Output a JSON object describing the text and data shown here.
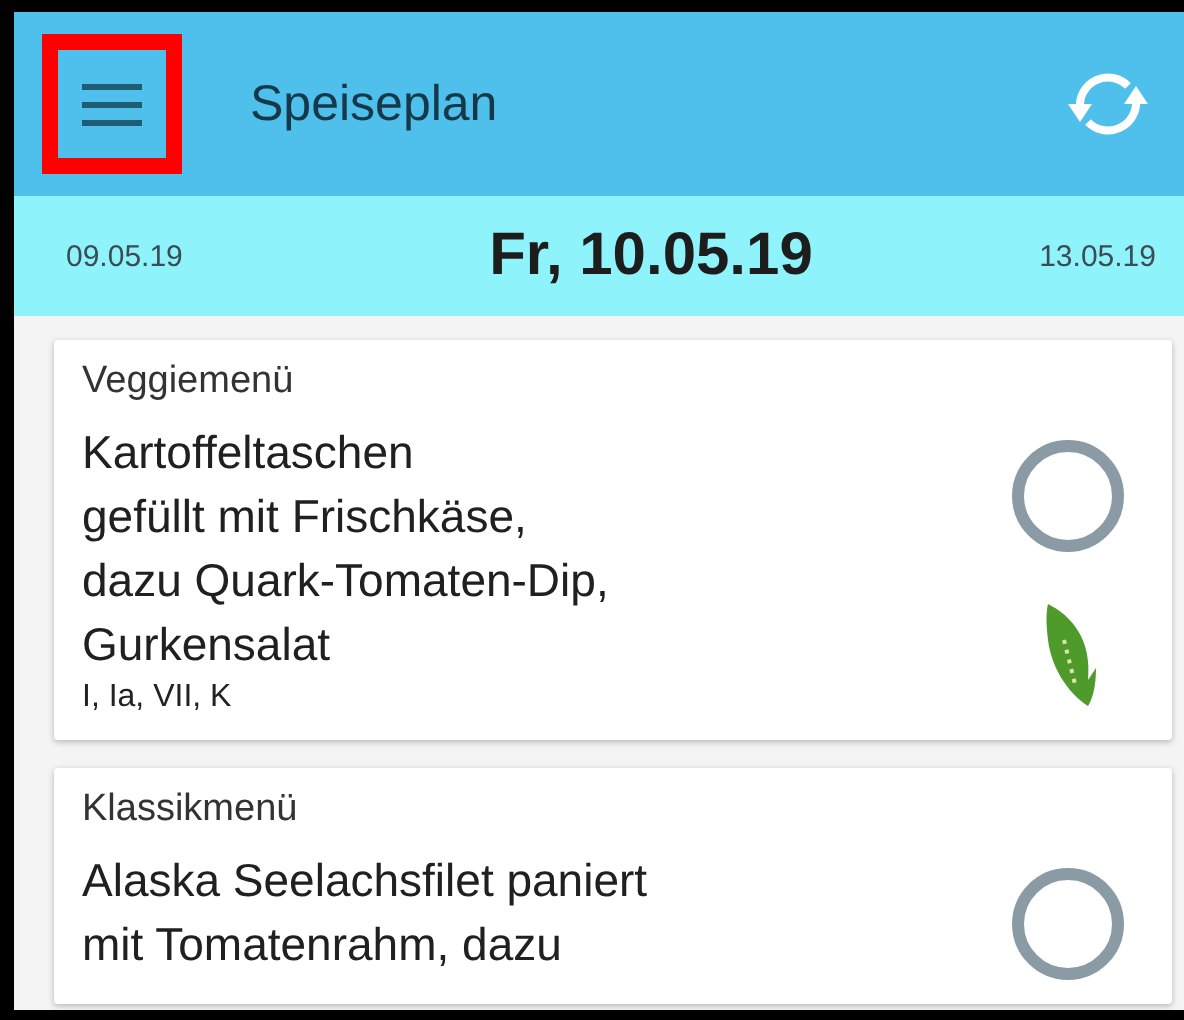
{
  "app_bar": {
    "title": "Speiseplan",
    "menu_highlighted": true
  },
  "date_bar": {
    "previous": "09.05.19",
    "current": "Fr, 10.05.19",
    "next": "13.05.19"
  },
  "menus": [
    {
      "category": "Veggiemenü",
      "lines": [
        "Kartoffeltaschen",
        "gefüllt mit Frischkäse,",
        "dazu Quark-Tomaten-Dip,",
        "Gurkensalat"
      ],
      "allergens": "I, Ia, VII, K",
      "selected": false,
      "vegetarian": true
    },
    {
      "category": "Klassikmenü",
      "lines": [
        "Alaska Seelachsfilet paniert",
        "mit Tomatenrahm, dazu"
      ],
      "selected": false,
      "vegetarian": false
    }
  ]
}
